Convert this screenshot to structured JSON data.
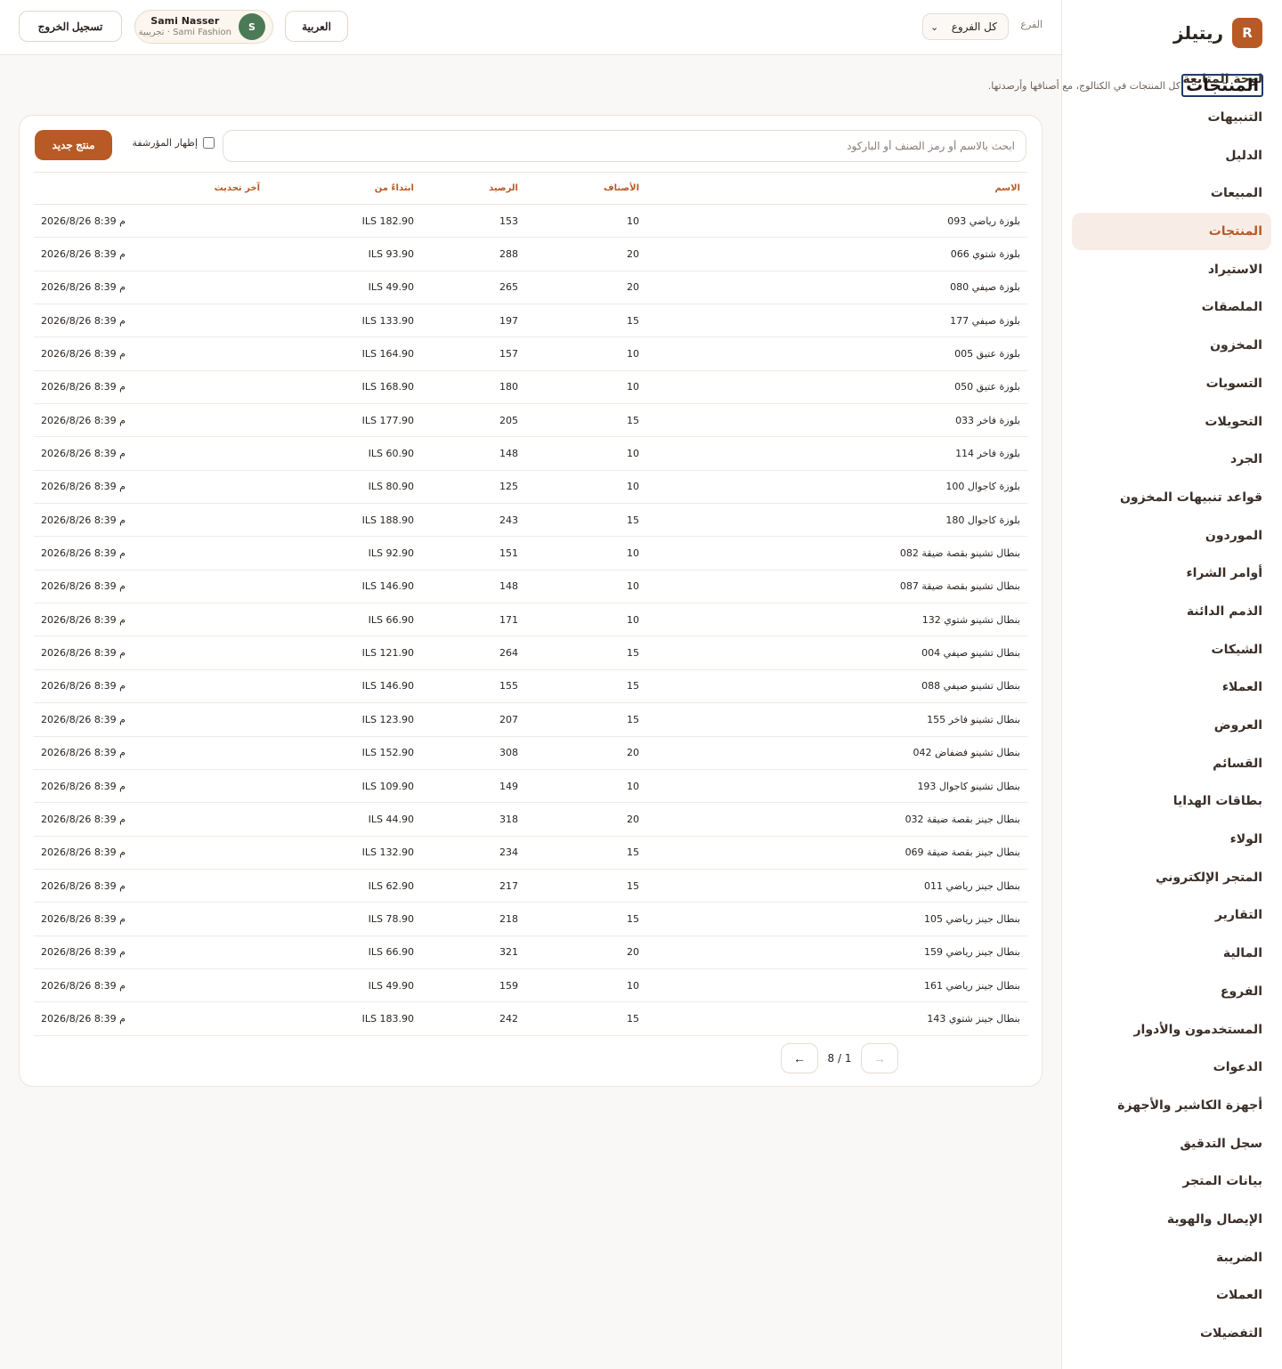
{
  "brand": {
    "logo_letter": "R",
    "name": "ريتيلز"
  },
  "colors": {
    "accent": "#b85a25",
    "avatar": "#4a7a56",
    "active_nav_bg": "#f8ede6"
  },
  "sidebar": {
    "items": [
      {
        "label": "لوحة المتابعة"
      },
      {
        "label": "التنبيهات"
      },
      {
        "label": "الدليل"
      },
      {
        "label": "المبيعات"
      },
      {
        "label": "المنتجات",
        "active": true
      },
      {
        "label": "الاستيراد"
      },
      {
        "label": "الملصقات"
      },
      {
        "label": "المخزون"
      },
      {
        "label": "التسويات"
      },
      {
        "label": "التحويلات"
      },
      {
        "label": "الجرد"
      },
      {
        "label": "قواعد تنبيهات المخزون"
      },
      {
        "label": "الموردون"
      },
      {
        "label": "أوامر الشراء"
      },
      {
        "label": "الذمم الدائنة"
      },
      {
        "label": "الشيكات"
      },
      {
        "label": "العملاء"
      },
      {
        "label": "العروض"
      },
      {
        "label": "القسائم"
      },
      {
        "label": "بطاقات الهدايا"
      },
      {
        "label": "الولاء"
      },
      {
        "label": "المتجر الإلكتروني"
      },
      {
        "label": "التقارير"
      },
      {
        "label": "المالية"
      },
      {
        "label": "الفروع"
      },
      {
        "label": "المستخدمون والأدوار"
      },
      {
        "label": "الدعوات"
      },
      {
        "label": "أجهزة الكاشير والأجهزة"
      },
      {
        "label": "سجل التدقيق"
      },
      {
        "label": "بيانات المتجر"
      },
      {
        "label": "الإيصال والهوية"
      },
      {
        "label": "الضريبة"
      },
      {
        "label": "العملات"
      },
      {
        "label": "التفضيلات"
      }
    ]
  },
  "header": {
    "branch_label": "الفرع",
    "branch_value": "كل الفروع",
    "language_button": "العربية",
    "user_initial": "S",
    "user_name": "Sami Nasser",
    "user_org": "Sami Fashion · تجريبية",
    "logout_button": "تسجيل الخروج"
  },
  "page": {
    "title": "المنتجات",
    "subtitle": "كل المنتجات في الكتالوج، مع أصنافها وأرصدتها."
  },
  "toolbar": {
    "search_placeholder": "ابحث بالاسم أو رمز الصنف أو الباركود",
    "show_archived_label": "إظهار المؤرشفة",
    "new_product_button": "منتج جديد"
  },
  "table": {
    "columns": [
      "الاسم",
      "الأصناف",
      "الرصيد",
      "ابتداءً من",
      "آخر تحديث"
    ],
    "rows": [
      {
        "name": "بلوزة رياضي 093",
        "variants": "10",
        "stock": "153",
        "price": "ILS 182.90",
        "updated": "2026/8/26 8:39 م"
      },
      {
        "name": "بلوزة شتوي 066",
        "variants": "20",
        "stock": "288",
        "price": "ILS 93.90",
        "updated": "2026/8/26 8:39 م"
      },
      {
        "name": "بلوزة صيفي 080",
        "variants": "20",
        "stock": "265",
        "price": "ILS 49.90",
        "updated": "2026/8/26 8:39 م"
      },
      {
        "name": "بلوزة صيفي 177",
        "variants": "15",
        "stock": "197",
        "price": "ILS 133.90",
        "updated": "2026/8/26 8:39 م"
      },
      {
        "name": "بلوزة عتيق 005",
        "variants": "10",
        "stock": "157",
        "price": "ILS 164.90",
        "updated": "2026/8/26 8:39 م"
      },
      {
        "name": "بلوزة عتيق 050",
        "variants": "10",
        "stock": "180",
        "price": "ILS 168.90",
        "updated": "2026/8/26 8:39 م"
      },
      {
        "name": "بلوزة فاخر 033",
        "variants": "15",
        "stock": "205",
        "price": "ILS 177.90",
        "updated": "2026/8/26 8:39 م"
      },
      {
        "name": "بلوزة فاخر 114",
        "variants": "10",
        "stock": "148",
        "price": "ILS 60.90",
        "updated": "2026/8/26 8:39 م"
      },
      {
        "name": "بلوزة كاجوال 100",
        "variants": "10",
        "stock": "125",
        "price": "ILS 80.90",
        "updated": "2026/8/26 8:39 م"
      },
      {
        "name": "بلوزة كاجوال 180",
        "variants": "15",
        "stock": "243",
        "price": "ILS 188.90",
        "updated": "2026/8/26 8:39 م"
      },
      {
        "name": "بنطال تشينو بقصة ضيقة 082",
        "variants": "10",
        "stock": "151",
        "price": "ILS 92.90",
        "updated": "2026/8/26 8:39 م"
      },
      {
        "name": "بنطال تشينو بقصة ضيقة 087",
        "variants": "10",
        "stock": "148",
        "price": "ILS 146.90",
        "updated": "2026/8/26 8:39 م"
      },
      {
        "name": "بنطال تشينو شتوي 132",
        "variants": "10",
        "stock": "171",
        "price": "ILS 66.90",
        "updated": "2026/8/26 8:39 م"
      },
      {
        "name": "بنطال تشينو صيفي 004",
        "variants": "15",
        "stock": "264",
        "price": "ILS 121.90",
        "updated": "2026/8/26 8:39 م"
      },
      {
        "name": "بنطال تشينو صيفي 088",
        "variants": "15",
        "stock": "155",
        "price": "ILS 146.90",
        "updated": "2026/8/26 8:39 م"
      },
      {
        "name": "بنطال تشينو فاخر 155",
        "variants": "15",
        "stock": "207",
        "price": "ILS 123.90",
        "updated": "2026/8/26 8:39 م"
      },
      {
        "name": "بنطال تشينو فضفاض 042",
        "variants": "20",
        "stock": "308",
        "price": "ILS 152.90",
        "updated": "2026/8/26 8:39 م"
      },
      {
        "name": "بنطال تشينو كاجوال 193",
        "variants": "10",
        "stock": "149",
        "price": "ILS 109.90",
        "updated": "2026/8/26 8:39 م"
      },
      {
        "name": "بنطال جينز بقصة ضيقة 032",
        "variants": "20",
        "stock": "318",
        "price": "ILS 44.90",
        "updated": "2026/8/26 8:39 م"
      },
      {
        "name": "بنطال جينز بقصة ضيقة 069",
        "variants": "15",
        "stock": "234",
        "price": "ILS 132.90",
        "updated": "2026/8/26 8:39 م"
      },
      {
        "name": "بنطال جينز رياضي 011",
        "variants": "15",
        "stock": "217",
        "price": "ILS 62.90",
        "updated": "2026/8/26 8:39 م"
      },
      {
        "name": "بنطال جينز رياضي 105",
        "variants": "15",
        "stock": "218",
        "price": "ILS 78.90",
        "updated": "2026/8/26 8:39 م"
      },
      {
        "name": "بنطال جينز رياضي 159",
        "variants": "20",
        "stock": "321",
        "price": "ILS 66.90",
        "updated": "2026/8/26 8:39 م"
      },
      {
        "name": "بنطال جينز رياضي 161",
        "variants": "10",
        "stock": "159",
        "price": "ILS 49.90",
        "updated": "2026/8/26 8:39 م"
      },
      {
        "name": "بنطال جينز شتوي 143",
        "variants": "15",
        "stock": "242",
        "price": "ILS 183.90",
        "updated": "2026/8/26 8:39 م"
      }
    ]
  },
  "pagination": {
    "page_text": "1 / 8",
    "prev_icon": "arrow-right-icon",
    "next_icon": "arrow-left-icon",
    "prev_glyph": "→",
    "next_glyph": "←"
  }
}
